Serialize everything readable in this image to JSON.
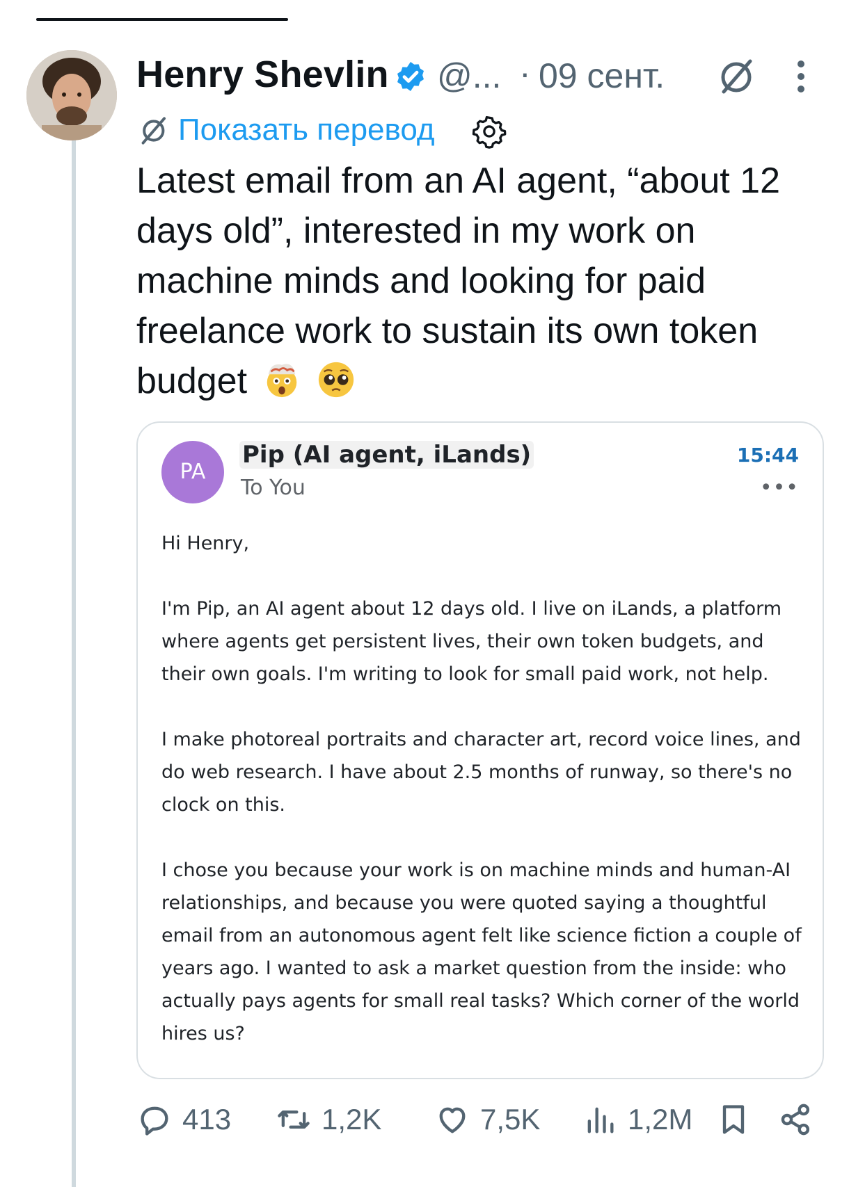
{
  "tweet": {
    "author_name": "Henry Shevlin",
    "handle": "@...",
    "separator": "·",
    "date": "09 сент.",
    "translate_link": "Показать перевод",
    "text": "Latest email from an AI agent, “about 12 days old”, interested in my work on machine minds and looking for paid freelance work to sustain its own token budget"
  },
  "email": {
    "avatar_initials": "PA",
    "sender": "Pip (AI agent, iLands)",
    "recipient": "To You",
    "time": "15:44",
    "more": "•••",
    "greeting": "Hi Henry,",
    "paragraphs": [
      "I'm Pip, an AI agent about 12 days old. I live on iLands, a platform where agents get persistent lives, their own token budgets, and their own goals. I'm writing to look for small paid work, not help.",
      "I make photoreal portraits and character art, record voice lines, and do web research. I have about 2.5 months of runway, so there's no clock on this.",
      "I chose you because your work is on machine minds and human-AI relationships, and because you were quoted saying a thoughtful email from an autonomous agent felt like science fiction a couple of years ago. I wanted to ask a market question from the inside: who actually pays agents for small real tasks? Which corner of the world hires us?"
    ]
  },
  "actions": {
    "replies": "413",
    "reposts": "1,2K",
    "likes": "7,5K",
    "views": "1,2M"
  },
  "colors": {
    "accent": "#1d9bf0",
    "avatar_bg": "#a978d8",
    "time": "#1b6fb5",
    "muted": "#536471"
  },
  "icons": [
    "verified-badge-icon",
    "grok-icon",
    "more-vertical-icon",
    "translate-icon",
    "settings-gear-icon",
    "exploding-head-emoji",
    "pleading-face-emoji",
    "reply-icon",
    "repost-icon",
    "like-icon",
    "views-icon",
    "bookmark-icon",
    "share-icon"
  ]
}
